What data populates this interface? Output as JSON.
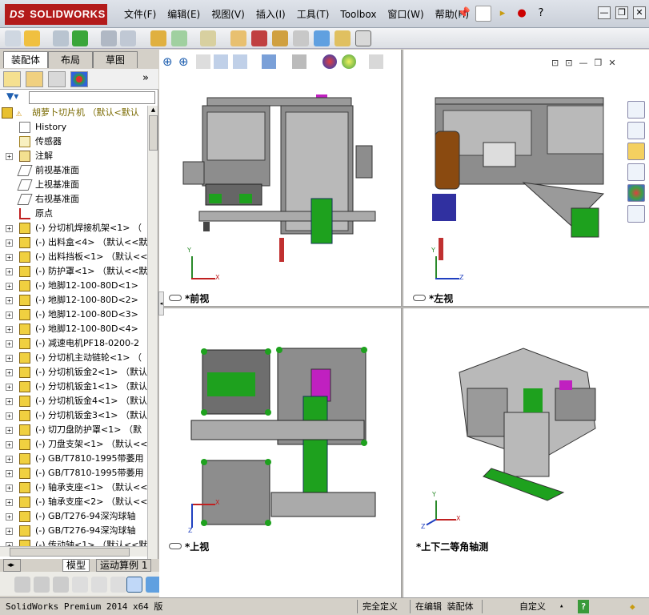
{
  "app": {
    "brand": "SOLIDWORKS",
    "brand_prefix": "DS"
  },
  "menus": [
    "文件(F)",
    "编辑(E)",
    "视图(V)",
    "插入(I)",
    "工具(T)",
    "Toolbox",
    "窗口(W)",
    "帮助(H)"
  ],
  "window_controls": {
    "minimize": "—",
    "restore": "❐",
    "close": "✕"
  },
  "pane_tabs": [
    "装配体",
    "布局",
    "草图"
  ],
  "feature_tree": {
    "root": "胡萝卜切片机 （默认<默认",
    "items": [
      {
        "label": "History",
        "icon": "history-icon",
        "expandable": false
      },
      {
        "label": "传感器",
        "icon": "sensor-icon",
        "expandable": false
      },
      {
        "label": "注解",
        "icon": "annotation-icon",
        "expandable": true
      },
      {
        "label": "前视基准面",
        "icon": "plane-icon",
        "expandable": false
      },
      {
        "label": "上视基准面",
        "icon": "plane-icon",
        "expandable": false
      },
      {
        "label": "右视基准面",
        "icon": "plane-icon",
        "expandable": false
      },
      {
        "label": "原点",
        "icon": "origin-icon",
        "expandable": false
      },
      {
        "label": "(-) 分切机焊接机架<1> （",
        "icon": "part-icon",
        "expandable": true
      },
      {
        "label": "(-) 出料盒<4> （默认<<默",
        "icon": "part-icon",
        "expandable": true
      },
      {
        "label": "(-) 出料挡板<1> （默认<<",
        "icon": "part-icon",
        "expandable": true
      },
      {
        "label": "(-) 防护罩<1> （默认<<默",
        "icon": "part-icon",
        "expandable": true
      },
      {
        "label": "(-) 地脚12-100-80D<1> （",
        "icon": "part-icon",
        "expandable": true
      },
      {
        "label": "(-) 地脚12-100-80D<2> （",
        "icon": "part-icon",
        "expandable": true
      },
      {
        "label": "(-) 地脚12-100-80D<3> （",
        "icon": "part-icon",
        "expandable": true
      },
      {
        "label": "(-) 地脚12-100-80D<4> （",
        "icon": "part-icon",
        "expandable": true
      },
      {
        "label": "(-) 减速电机PF18-0200-2",
        "icon": "part-icon",
        "expandable": true
      },
      {
        "label": "(-) 分切机主动链轮<1> （",
        "icon": "part-icon",
        "expandable": true
      },
      {
        "label": "(-) 分切机钣金2<1> （默认",
        "icon": "part-icon",
        "expandable": true
      },
      {
        "label": "(-) 分切机钣金1<1> （默认",
        "icon": "part-icon",
        "expandable": true
      },
      {
        "label": "(-) 分切机钣金4<1> （默认",
        "icon": "part-icon",
        "expandable": true
      },
      {
        "label": "(-) 分切机钣金3<1> （默认",
        "icon": "part-icon",
        "expandable": true
      },
      {
        "label": "(-) 切刀盘防护罩<1> （默",
        "icon": "part-icon",
        "expandable": true
      },
      {
        "label": "(-) 刀盘支架<1> （默认<<",
        "icon": "part-icon",
        "expandable": true
      },
      {
        "label": "(-) GB/T7810-1995带萎用",
        "icon": "part-icon",
        "expandable": true
      },
      {
        "label": "(-) GB/T7810-1995带萎用",
        "icon": "part-icon",
        "expandable": true
      },
      {
        "label": "(-) 轴承支座<1> （默认<<",
        "icon": "part-icon",
        "expandable": true
      },
      {
        "label": "(-) 轴承支座<2> （默认<<",
        "icon": "part-icon",
        "expandable": true
      },
      {
        "label": "(-) GB/T276-94深沟球轴",
        "icon": "part-icon",
        "expandable": true
      },
      {
        "label": "(-) GB/T276-94深沟球轴",
        "icon": "part-icon",
        "expandable": true
      },
      {
        "label": "(-) 传动轴<1> （默认<<默",
        "icon": "part-icon",
        "expandable": true
      }
    ]
  },
  "bottom_tabs": [
    "模型",
    "运动算例 1"
  ],
  "views": [
    {
      "label": "*前视",
      "axes": [
        "Y",
        "X"
      ]
    },
    {
      "label": "*左视",
      "axes": [
        "Y",
        "Z"
      ]
    },
    {
      "label": "*上视",
      "axes": [
        "X",
        "Z"
      ]
    },
    {
      "label": "*上下二等角轴测",
      "axes": [
        "Y",
        "X",
        "Z"
      ]
    }
  ],
  "status": {
    "version": "SolidWorks Premium 2014 x64 版",
    "definition": "完全定义",
    "mode": "在编辑 装配体",
    "units": "自定义",
    "units_caret": "▴",
    "help": "?"
  },
  "colors": {
    "accent": "#b31b1b",
    "tree_root": "#7a6a00",
    "machine_green": "#1ea11e",
    "machine_magenta": "#c020c0",
    "machine_grey": "#8f8f8f"
  }
}
